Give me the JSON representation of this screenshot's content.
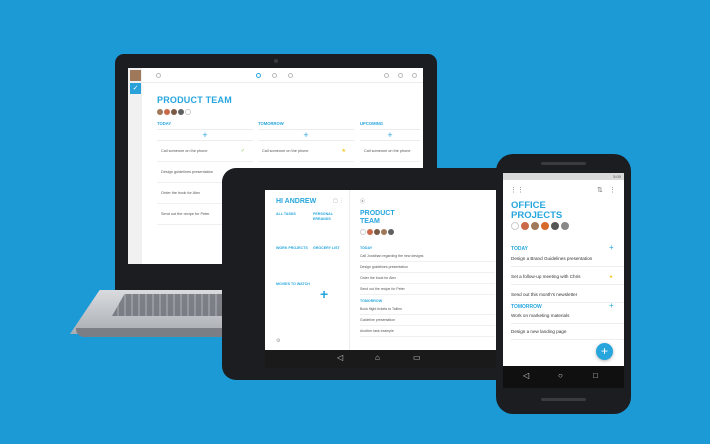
{
  "colors": {
    "background": "#1b9ad6",
    "accent": "#27a6de",
    "star": "#f5c518"
  },
  "laptop": {
    "title": "PRODUCT TEAM",
    "columns": [
      {
        "header": "TODAY",
        "tasks": [
          "Call someone on the phone",
          "Design guidelines presentation",
          "Order the book for Alex",
          "Send out the recipe for Peter"
        ]
      },
      {
        "header": "TOMORROW",
        "tasks": [
          "Call someone on the phone"
        ]
      },
      {
        "header": "UPCOMING",
        "tasks": [
          "Call someone on the phone"
        ]
      }
    ]
  },
  "tablet": {
    "greeting": "HI ANDREW",
    "lists": [
      "ALL TASKS",
      "PERSONAL ERRANDS",
      "WORK PROJECTS",
      "GROCERY LIST",
      "MOVIES TO WATCH"
    ],
    "title_line1": "PRODUCT",
    "title_line2": "TEAM",
    "today_label": "TODAY",
    "today_tasks": [
      "Call Jonathan regarding the new designs",
      "Design guidelines presentation",
      "Order the book for Alex",
      "Send out the recipe for Peter"
    ],
    "tomorrow_label": "TOMORROW",
    "tomorrow_tasks": [
      "Book flight tickets to Tallinn",
      "Guideline presentation",
      "Another task example"
    ]
  },
  "phone": {
    "status_time": "5:00",
    "title_line1": "OFFICE",
    "title_line2": "PROJECTS",
    "today_label": "TODAY",
    "today_tasks": [
      "Design a Brand Guidelines presentation",
      "Set a follow-up meeting with Chris",
      "Send out this month's newsletter"
    ],
    "tomorrow_label": "TOMORROW",
    "tomorrow_tasks": [
      "Work on marketing materials",
      "Design a new landing page"
    ]
  },
  "icons": [
    "check-icon",
    "plus-icon",
    "star-icon",
    "grid-icon",
    "more-icon",
    "back-icon",
    "home-icon",
    "recents-icon"
  ]
}
